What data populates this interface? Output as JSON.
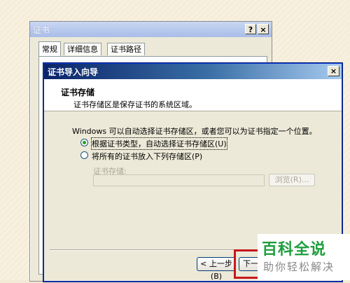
{
  "back_window": {
    "title": "证书",
    "help_btn": "?",
    "close_btn": "×",
    "tabs": [
      {
        "label": "常规"
      },
      {
        "label": "详细信息"
      },
      {
        "label": "证书路径"
      }
    ]
  },
  "wizard": {
    "title": "证书导入向导",
    "close_btn": "×",
    "header_title": "证书存储",
    "header_desc": "证书存储区是保存证书的系统区域。",
    "body_text": "Windows 可以自动选择证书存储区，或者您可以为证书指定一个位置。",
    "radio_auto": "根据证书类型，自动选择证书存储区(U)",
    "radio_manual": "将所有的证书放入下列存储区(P)",
    "store_label": "证书存储:",
    "store_value": "",
    "browse_btn": "浏览(R)...",
    "back_btn": "< 上一步(B)",
    "next_btn": "下一步"
  },
  "watermark": {
    "line1": "百科全说",
    "line2": "助你轻松解决"
  },
  "colors": {
    "titlebar_active": "#0a246a",
    "highlight": "#c8161d",
    "watermark_green": "#1e9e3e"
  }
}
